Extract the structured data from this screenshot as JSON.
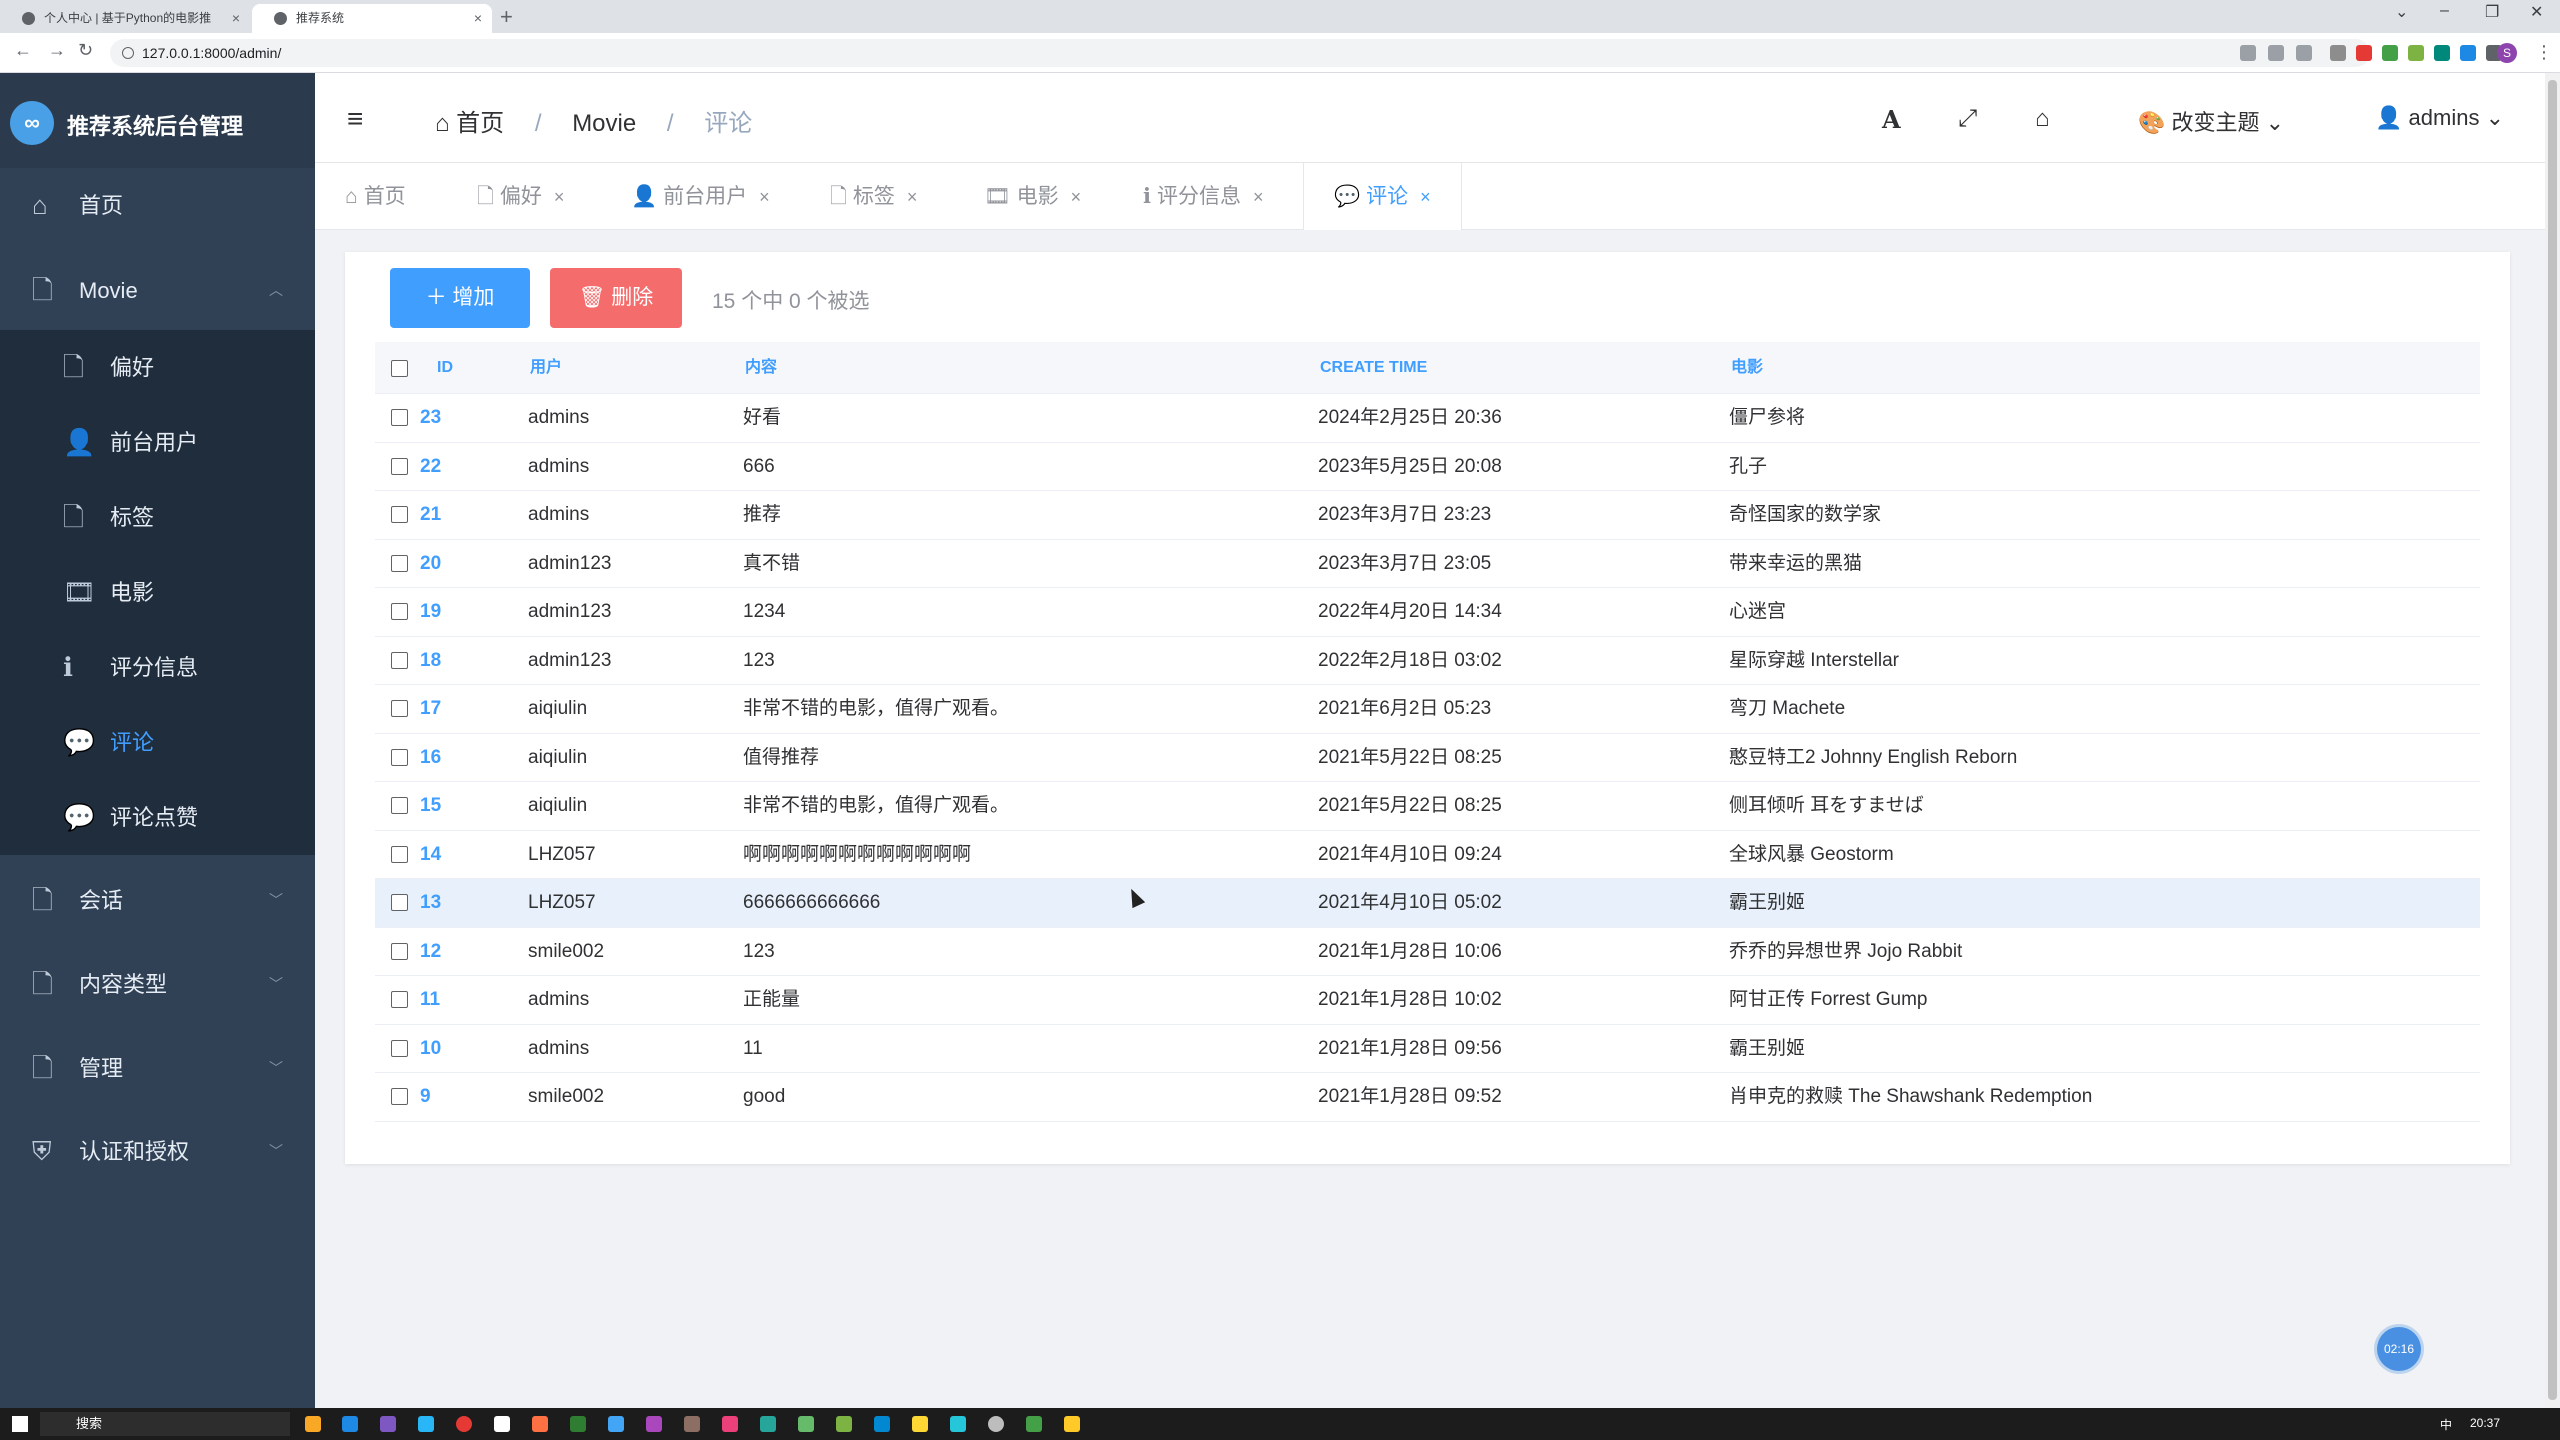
{
  "browser": {
    "tabs": [
      {
        "title": "个人中心 | 基于Python的电影推",
        "close": "×"
      },
      {
        "title": "推荐系统",
        "close": "×"
      }
    ],
    "new_tab": "+",
    "url": "127.0.0.1:8000/admin/",
    "profile_initial": "S"
  },
  "sidebar": {
    "logo_mark": "∞",
    "logo_text": "推荐系统后台管理",
    "items": [
      {
        "icon": "home-icon",
        "glyph": "⌂",
        "label": "首页"
      },
      {
        "icon": "file-icon",
        "glyph": "🗋",
        "label": "Movie",
        "arrow": "︿"
      },
      {
        "icon": "file-icon",
        "glyph": "🗋",
        "label": "偏好"
      },
      {
        "icon": "user-icon",
        "glyph": "👤",
        "label": "前台用户"
      },
      {
        "icon": "file-icon",
        "glyph": "🗋",
        "label": "标签"
      },
      {
        "icon": "film-icon",
        "glyph": "🎞",
        "label": "电影"
      },
      {
        "icon": "info-icon",
        "glyph": "ℹ",
        "label": "评分信息"
      },
      {
        "icon": "comments-icon",
        "glyph": "💬",
        "label": "评论"
      },
      {
        "icon": "comments-icon",
        "glyph": "💬",
        "label": "评论点赞"
      },
      {
        "icon": "file-icon",
        "glyph": "🗋",
        "label": "会话",
        "arrow": "﹀"
      },
      {
        "icon": "file-icon",
        "glyph": "🗋",
        "label": "内容类型",
        "arrow": "﹀"
      },
      {
        "icon": "file-icon",
        "glyph": "🗋",
        "label": "管理",
        "arrow": "﹀"
      },
      {
        "icon": "shield-icon",
        "glyph": "⛨",
        "label": "认证和授权",
        "arrow": "﹀"
      }
    ]
  },
  "navbar": {
    "hamburger": "≡",
    "breadcrumb": [
      "首页",
      "Movie",
      "评论"
    ],
    "breadcrumb_sep": "/",
    "home_glyph": "⌂",
    "font_glyph": "A",
    "fullscreen_glyph": "⤢",
    "home_tool_glyph": "⌂",
    "theme_label": "改变主题",
    "user_label": "admins",
    "caret": "⌄"
  },
  "tag_tabs": [
    {
      "glyph": "⌂",
      "label": "首页"
    },
    {
      "glyph": "🗋",
      "label": "偏好",
      "close": "×"
    },
    {
      "glyph": "👤",
      "label": "前台用户",
      "close": "×"
    },
    {
      "glyph": "🗋",
      "label": "标签",
      "close": "×"
    },
    {
      "glyph": "🎞",
      "label": "电影",
      "close": "×"
    },
    {
      "glyph": "ℹ",
      "label": "评分信息",
      "close": "×"
    },
    {
      "glyph": "💬",
      "label": "评论",
      "close": "×"
    }
  ],
  "toolbar": {
    "add_label": "＋ 增加",
    "delete_label": "🗑 删除",
    "selection_status": "15 个中 0 个被选"
  },
  "table": {
    "columns": [
      "ID",
      "用户",
      "内容",
      "CREATE TIME",
      "电影"
    ],
    "rows": [
      {
        "id": "23",
        "user": "admins",
        "content": "好看",
        "time": "2024年2月25日 20:36",
        "movie": "僵尸参将"
      },
      {
        "id": "22",
        "user": "admins",
        "content": "666",
        "time": "2023年5月25日 20:08",
        "movie": "孔子"
      },
      {
        "id": "21",
        "user": "admins",
        "content": "推荐",
        "time": "2023年3月7日 23:23",
        "movie": "奇怪国家的数学家"
      },
      {
        "id": "20",
        "user": "admin123",
        "content": "真不错",
        "time": "2023年3月7日 23:05",
        "movie": "带来幸运的黑猫"
      },
      {
        "id": "19",
        "user": "admin123",
        "content": "1234",
        "time": "2022年4月20日 14:34",
        "movie": "心迷宫"
      },
      {
        "id": "18",
        "user": "admin123",
        "content": "123",
        "time": "2022年2月18日 03:02",
        "movie": "星际穿越 Interstellar"
      },
      {
        "id": "17",
        "user": "aiqiulin",
        "content": "非常不错的电影，值得广观看。",
        "time": "2021年6月2日 05:23",
        "movie": "弯刀 Machete"
      },
      {
        "id": "16",
        "user": "aiqiulin",
        "content": "值得推荐",
        "time": "2021年5月22日 08:25",
        "movie": "憨豆特工2 Johnny English Reborn"
      },
      {
        "id": "15",
        "user": "aiqiulin",
        "content": "非常不错的电影，值得广观看。",
        "time": "2021年5月22日 08:25",
        "movie": "侧耳倾听 耳をすませば"
      },
      {
        "id": "14",
        "user": "LHZ057",
        "content": "啊啊啊啊啊啊啊啊啊啊啊啊",
        "time": "2021年4月10日 09:24",
        "movie": "全球风暴 Geostorm"
      },
      {
        "id": "13",
        "user": "LHZ057",
        "content": "6666666666666",
        "time": "2021年4月10日 05:02",
        "movie": "霸王别姬"
      },
      {
        "id": "12",
        "user": "smile002",
        "content": "123",
        "time": "2021年1月28日 10:06",
        "movie": "乔乔的异想世界 Jojo Rabbit"
      },
      {
        "id": "11",
        "user": "admins",
        "content": "正能量",
        "time": "2021年1月28日 10:02",
        "movie": "阿甘正传 Forrest Gump"
      },
      {
        "id": "10",
        "user": "admins",
        "content": "11",
        "time": "2021年1月28日 09:56",
        "movie": "霸王别姬"
      },
      {
        "id": "9",
        "user": "smile002",
        "content": "good",
        "time": "2021年1月28日 09:52",
        "movie": "肖申克的救赎 The Shawshank Redemption"
      }
    ]
  },
  "timer": "02:16",
  "taskbar": {
    "search_label": "搜索",
    "clock": "20:37",
    "ime": "中"
  }
}
